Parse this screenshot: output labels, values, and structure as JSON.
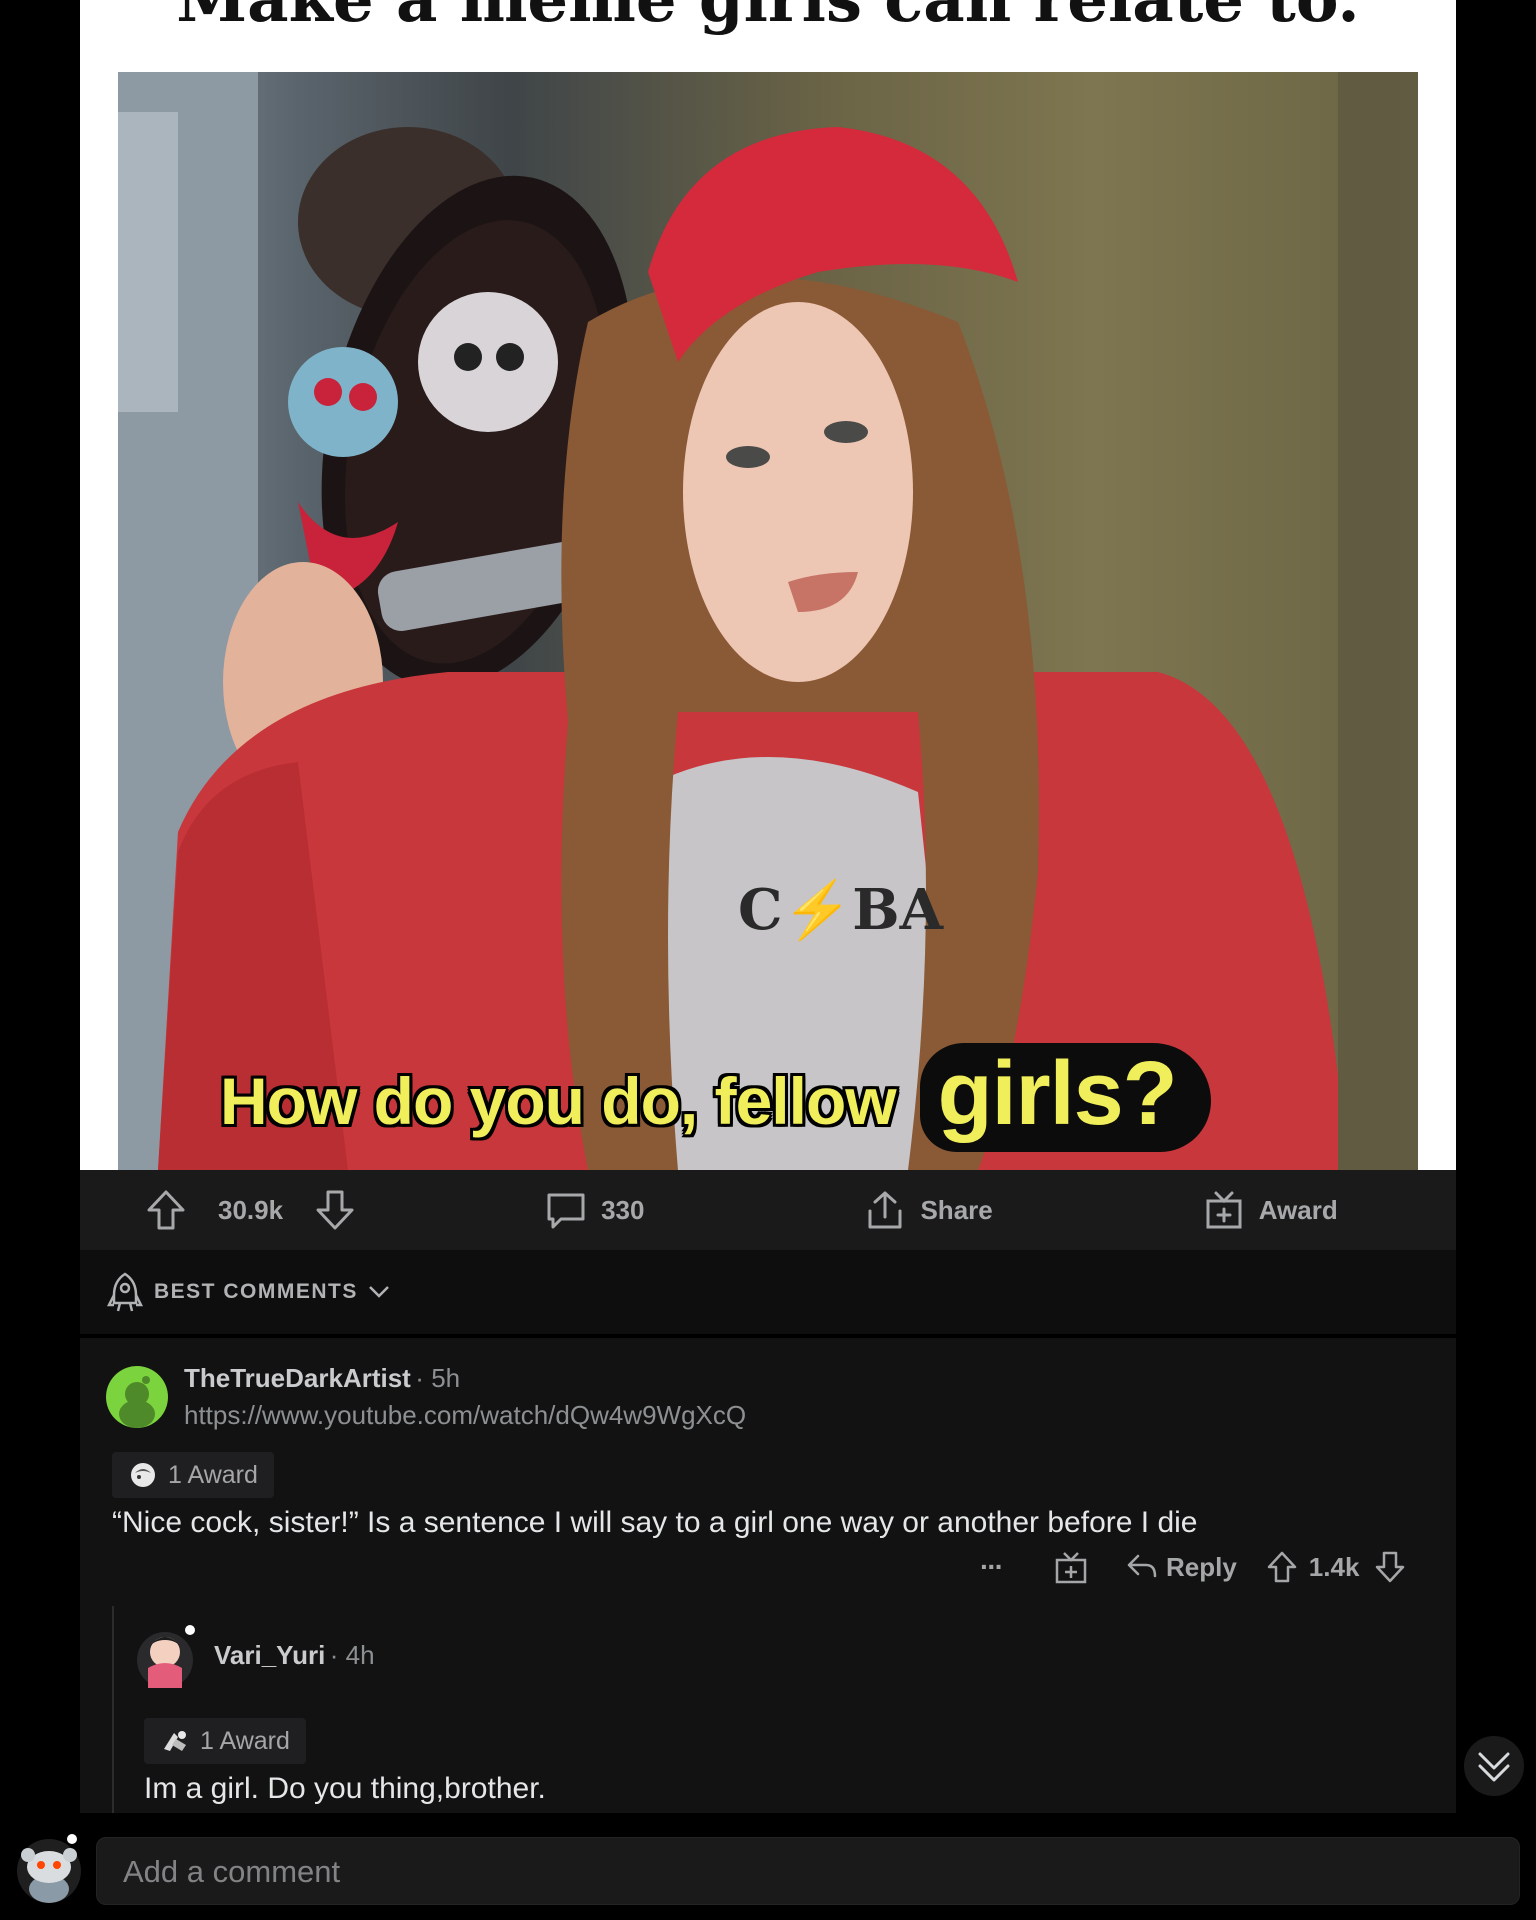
{
  "post": {
    "meme_title": "Make a meme girls can relate to.",
    "meme_caption_main": "How do you do, fellow",
    "meme_caption_emph": "girls?",
    "shirt_text": "C⚡BA",
    "upvotes": "30.9k",
    "comments": "330",
    "share_label": "Share",
    "award_label": "Award"
  },
  "sort": {
    "label": "BEST COMMENTS"
  },
  "comments": [
    {
      "username": "TheTrueDarkArtist",
      "time": "5h",
      "flair": "https://www.youtube.com/watch/dQw4w9WgXcQ",
      "award": "1 Award",
      "body": "“Nice cock, sister!” Is a sentence I will say to a girl one way or another before I die",
      "more": "···",
      "reply_label": "Reply",
      "score": "1.4k"
    },
    {
      "username": "Vari_Yuri",
      "time": "4h",
      "award": "1 Award",
      "body": "Im a girl. Do you thing,brother."
    }
  ],
  "input": {
    "placeholder": "Add a comment"
  },
  "colors": {
    "background": "#000000",
    "card": "#121212",
    "text": "#d7dadc",
    "caption": "#f0ee5a"
  },
  "icons": [
    "upvote-icon",
    "downvote-icon",
    "comment-icon",
    "share-icon",
    "award-icon",
    "best-sort-icon",
    "chevron-down-icon",
    "gift-icon",
    "reply-icon",
    "scroll-down-icon",
    "snoo-avatar"
  ]
}
